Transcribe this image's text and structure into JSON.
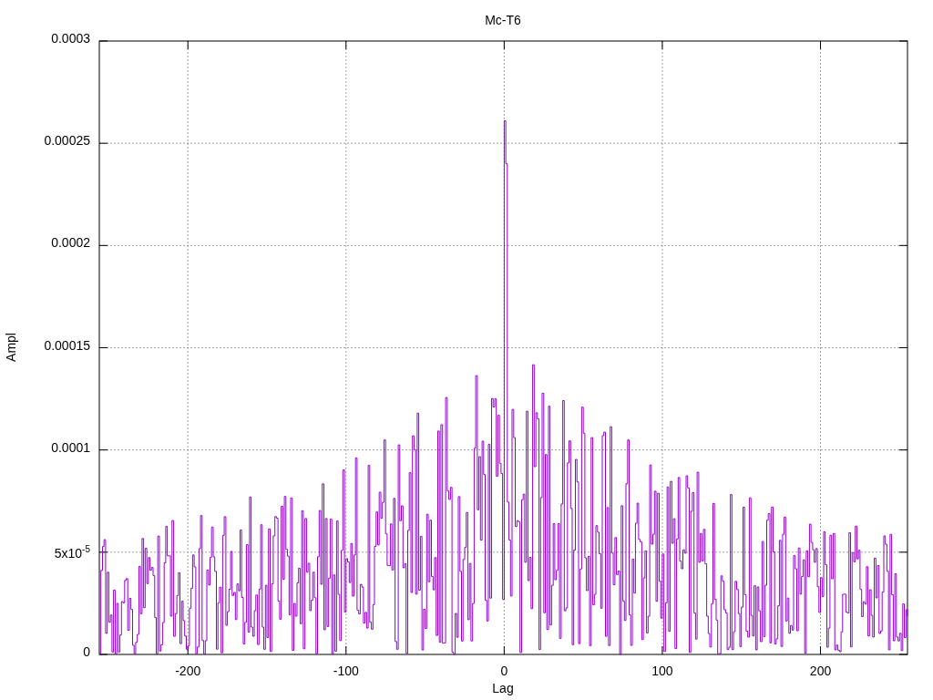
{
  "chart_data": {
    "type": "line",
    "title": "Mc-T6",
    "xlabel": "Lag",
    "ylabel": "Ampl",
    "grid": true,
    "xlim": [
      -256,
      255
    ],
    "ylim": [
      0,
      0.0003
    ],
    "xticks": [
      {
        "value": -200,
        "label": "-200"
      },
      {
        "value": -100,
        "label": "-100"
      },
      {
        "value": 0,
        "label": "0"
      },
      {
        "value": 100,
        "label": "100"
      },
      {
        "value": 200,
        "label": "200"
      }
    ],
    "yticks": [
      {
        "value": 0,
        "label": "0"
      },
      {
        "value": 5e-05,
        "label": "5x10$^{-5}$"
      },
      {
        "value": 0.0001,
        "label": "0.0001"
      },
      {
        "value": 0.00015,
        "label": "0.00015"
      },
      {
        "value": 0.0002,
        "label": "0.0002"
      },
      {
        "value": 0.00025,
        "label": "0.00025"
      },
      {
        "value": 0.0003,
        "label": "0.0003"
      }
    ]
  }
}
